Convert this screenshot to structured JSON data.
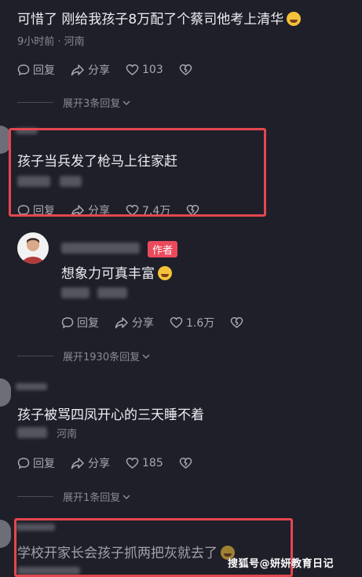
{
  "comments": [
    {
      "text": "可惜了 刚给我孩子8万配了个蔡司他考上清华",
      "meta": "9小时前 · 河南",
      "reply": "回复",
      "share": "分享",
      "likes": "103"
    },
    {
      "text": "孩子当兵发了枪马上往家赶",
      "reply": "回复",
      "share": "分享",
      "likes": "7.4万"
    },
    {
      "text": "想象力可真丰富",
      "author_badge": "作者",
      "reply": "回复",
      "share": "分享",
      "likes": "1.6万"
    },
    {
      "text": "孩子被骂四凤开心的三天睡不着",
      "meta": "河南",
      "reply": "回复",
      "share": "分享",
      "likes": "185"
    },
    {
      "text": "学校开家长会孩子抓两把灰就去了"
    }
  ],
  "expanders": [
    "展开3条回复",
    "展开1930条回复",
    "展开1条回复"
  ],
  "watermark": "搜狐号@妍妍教育日记",
  "colors": {
    "background": "#1f1f29",
    "highlight": "#e4474f",
    "author": "#ea4a5c"
  },
  "icons": {
    "reply": "comment-icon",
    "share": "share-icon",
    "like": "heart-icon",
    "dislike": "broken-heart-icon"
  }
}
